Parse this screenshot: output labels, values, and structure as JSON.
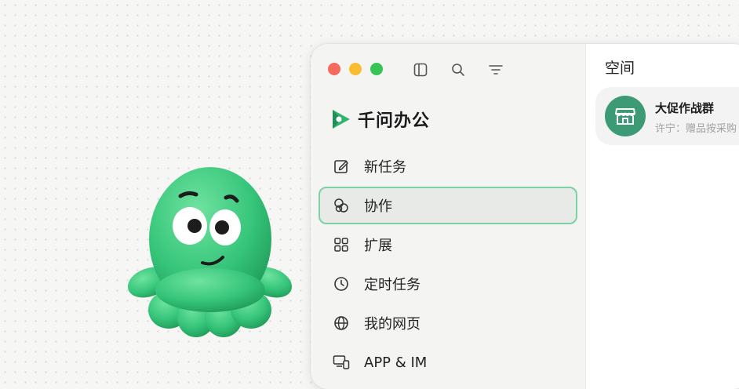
{
  "brand": {
    "name": "千问办公"
  },
  "menu": [
    {
      "label": "新任务",
      "icon": "edit-icon"
    },
    {
      "label": "协作",
      "icon": "collaboration-icon",
      "active": true
    },
    {
      "label": "扩展",
      "icon": "grid-icon"
    },
    {
      "label": "定时任务",
      "icon": "clock-icon"
    },
    {
      "label": "我的网页",
      "icon": "globe-icon"
    },
    {
      "label": "APP & IM",
      "icon": "devices-icon"
    }
  ],
  "panel": {
    "title": "空间",
    "card": {
      "title": "大促作战群",
      "subtitle": "许宁：赠品按采购",
      "icon": "store-icon"
    }
  },
  "colors": {
    "accent": "#2fb36e",
    "active_border": "#7fd0a4",
    "avatar_bg": "#3c9a74"
  }
}
